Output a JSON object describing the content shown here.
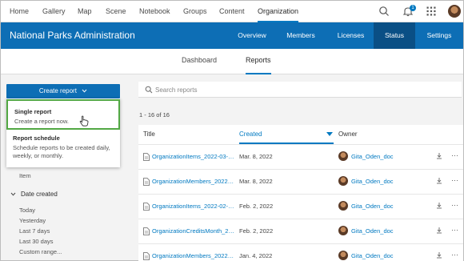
{
  "topnav": {
    "items": [
      "Home",
      "Gallery",
      "Map",
      "Scene",
      "Notebook",
      "Groups",
      "Content",
      "Organization"
    ],
    "notification_count": "1"
  },
  "orgbar": {
    "title": "National Parks Administration",
    "tabs": [
      "Overview",
      "Members",
      "Licenses",
      "Status",
      "Settings"
    ]
  },
  "subtabs": [
    "Dashboard",
    "Reports"
  ],
  "left": {
    "create_label": "Create report",
    "menu": [
      {
        "title": "Single report",
        "desc": "Create a report now."
      },
      {
        "title": "Report schedule",
        "desc_lines": [
          "Schedule reports to be created daily,",
          "weekly, or monthly."
        ]
      }
    ],
    "filter_item_partial": "Item",
    "date_created_label": "Date created",
    "date_options": [
      "Today",
      "Yesterday",
      "Last 7 days",
      "Last 30 days",
      "Custom range..."
    ]
  },
  "search": {
    "placeholder": "Search reports"
  },
  "count_text": "1 - 16 of 16",
  "table": {
    "headers": {
      "title": "Title",
      "created": "Created",
      "owner": "Owner"
    },
    "rows": [
      {
        "title": "OrganizationItems_2022-03-08",
        "created": "Mar. 8, 2022",
        "owner": "Gita_Oden_doc"
      },
      {
        "title": "OrganizationMembers_2022-03-08",
        "created": "Mar. 8, 2022",
        "owner": "Gita_Oden_doc"
      },
      {
        "title": "OrganizationItems_2022-02-02",
        "created": "Feb. 2, 2022",
        "owner": "Gita_Oden_doc"
      },
      {
        "title": "OrganizationCreditsMonth_2022-02-02",
        "created": "Feb. 2, 2022",
        "owner": "Gita_Oden_doc"
      },
      {
        "title": "OrganizationMembers_2022-01-04",
        "created": "Jan. 4, 2022",
        "owner": "Gita_Oden_doc"
      }
    ]
  },
  "colors": {
    "brand_blue": "#0d6eb5",
    "link_blue": "#0079c1",
    "highlight_green": "#52a844"
  }
}
